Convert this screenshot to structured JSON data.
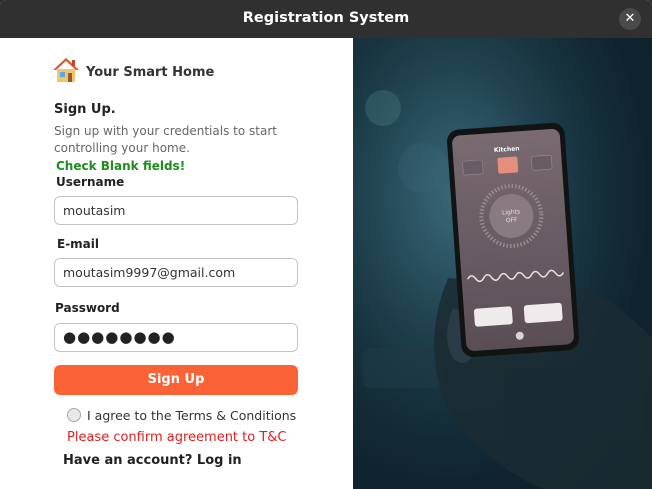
{
  "window": {
    "title": "Registration System",
    "close_glyph": "✕"
  },
  "brand": {
    "name": "Your Smart Home",
    "icon": "house-icon"
  },
  "form": {
    "heading": "Sign Up.",
    "subtitle": "Sign up with your credentials to start controlling your home.",
    "validation_message": "Check Blank fields!",
    "username": {
      "label": "Username",
      "value": "moutasim"
    },
    "email": {
      "label": "E-mail",
      "value": "moutasim9997@gmail.com"
    },
    "password": {
      "label": "Password",
      "value": "●●●●●●●●"
    },
    "submit_label": "Sign Up",
    "agree_label": "I agree to the Terms & Conditions",
    "agree_checked": false,
    "agree_error": "Please confirm agreement to T&C",
    "login_prompt": "Have an account? Log in"
  },
  "phone_screen": {
    "room": "Kitchen",
    "lights_line1": "Lights",
    "lights_line2": "OFF"
  },
  "colors": {
    "accent": "#fb6337",
    "success": "#1e8c1e",
    "error": "#e31e1e",
    "titlebar": "#303030"
  }
}
